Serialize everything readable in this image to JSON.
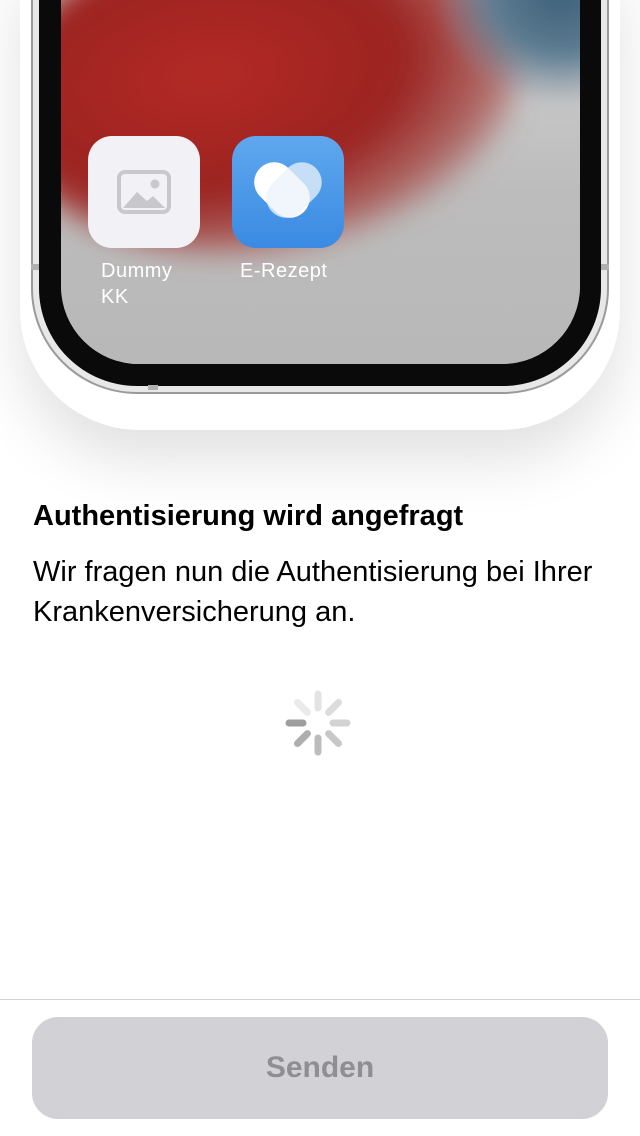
{
  "phone": {
    "apps": [
      {
        "label": "Dummy\nKK",
        "icon": "image-placeholder-icon"
      },
      {
        "label": "E-Rezept",
        "icon": "e-rezept-heart-icon"
      }
    ]
  },
  "content": {
    "title": "Authentisierung wird angefragt",
    "body": "Wir fragen nun die Authentisierung bei Ihrer Krankenversicherung an.",
    "spinner_icon": "loading-spinner-icon"
  },
  "footer": {
    "send_label": "Senden",
    "send_enabled": false
  },
  "colors": {
    "button_bg": "#d1d1d6",
    "button_text": "#8e8e93",
    "app_blue": "#3a8ae3"
  }
}
